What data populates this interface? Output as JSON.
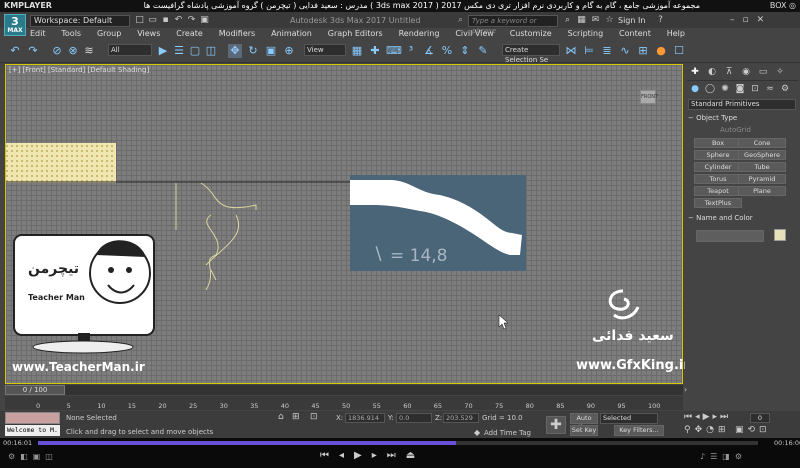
{
  "player": {
    "name": "KMPLAYER",
    "title": "مجموعه آموزشی جامع ، گام به گام و کاربردی نرم افزار تری دی مکس 2017  ( 3ds max 2017 )  مدرس : سعید فدایی ( تیچرمن ) گروه آموزشی پادشاه گرافیست ها",
    "right_label": "BOX ◎",
    "time_elapsed": "00:16:01",
    "time_total": "00:16:00",
    "progress_fraction": 0.58
  },
  "app": {
    "logo": "3",
    "logo_sub": "MAX",
    "workspace": "Workspace: Default",
    "title": "Autodesk 3ds Max 2017    Untitled",
    "search_placeholder": "Type a keyword or phrase",
    "sign_in": "Sign In"
  },
  "menu": [
    "Edit",
    "Tools",
    "Group",
    "Views",
    "Create",
    "Modifiers",
    "Animation",
    "Graph Editors",
    "Rendering",
    "Civil View",
    "Customize",
    "Scripting",
    "Content",
    "Help"
  ],
  "toolbar": {
    "filter_all": "All",
    "ref_coord": "View",
    "selection_set": "Create Selection Se"
  },
  "viewport": {
    "label": "[+] [Front] [Standard] [Default Shading]",
    "viewcube_label": "FRONT",
    "molding_value": "= 14,8"
  },
  "watermarks": {
    "teacher_name": "Teacher Man",
    "teacher_url": "www.TeacherMan.ir",
    "gfx_name": "سعید فدائی",
    "gfx_url": "www.GfxKing.ir"
  },
  "command_panel": {
    "category": "Standard Primitives",
    "object_type_header": "Object Type",
    "autogrid": "AutoGrid",
    "buttons": [
      "Box",
      "Cone",
      "Sphere",
      "GeoSphere",
      "Cylinder",
      "Tube",
      "Torus",
      "Pyramid",
      "Teapot",
      "Plane",
      "TextPlus"
    ],
    "name_color_header": "Name and Color"
  },
  "timeline": {
    "slider": "0 / 100",
    "ticks": [
      "0",
      "5",
      "10",
      "15",
      "20",
      "25",
      "30",
      "35",
      "40",
      "45",
      "50",
      "55",
      "60",
      "65",
      "70",
      "75",
      "80",
      "85",
      "90",
      "95",
      "100"
    ]
  },
  "status": {
    "welcome": "Welcome to M.",
    "selection": "None Selected",
    "prompt": "Click and drag to select and move objects",
    "x_label": "X:",
    "x_value": "1836.914",
    "y_label": "Y:",
    "y_value": "0.0",
    "z_label": "Z:",
    "z_value": "203.529",
    "grid": "Grid = 10.0",
    "add_time_tag": "Add Time Tag",
    "auto_key": "Auto Key",
    "set_key": "Set Key",
    "selected": "Selected",
    "key_filters": "Key Filters...",
    "frame": "0"
  }
}
